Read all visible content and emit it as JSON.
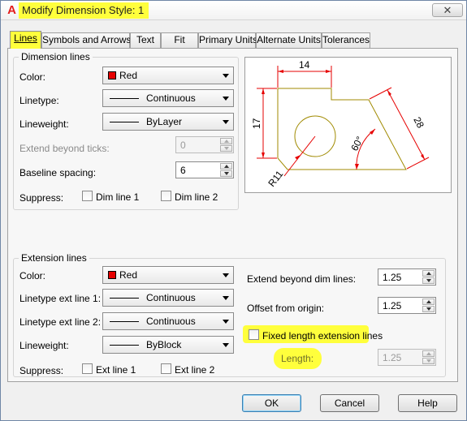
{
  "window": {
    "title": "Modify Dimension Style: 1",
    "icon": "autocad-a-icon",
    "close_label": "✕"
  },
  "tabs": [
    {
      "label": "Lines",
      "active": true
    },
    {
      "label": "Symbols and Arrows"
    },
    {
      "label": "Text"
    },
    {
      "label": "Fit"
    },
    {
      "label": "Primary Units"
    },
    {
      "label": "Alternate Units"
    },
    {
      "label": "Tolerances"
    }
  ],
  "dimension_lines": {
    "group_label": "Dimension lines",
    "color_label": "Color:",
    "color_value": "Red",
    "color_hex": "#e60000",
    "linetype_label": "Linetype:",
    "linetype_value": "Continuous",
    "lineweight_label": "Lineweight:",
    "lineweight_value": "ByLayer",
    "extend_label": "Extend beyond ticks:",
    "extend_value": "0",
    "baseline_label": "Baseline spacing:",
    "baseline_value": "6",
    "suppress_label": "Suppress:",
    "dim_line_1": "Dim line 1",
    "dim_line_2": "Dim line 2"
  },
  "preview": {
    "dim_top": "14",
    "dim_left": "17",
    "dim_diag": "28",
    "dim_angle": "60°",
    "dim_radius": "R11",
    "geometry_color": "#a08a00",
    "dim_color": "#e60000"
  },
  "extension_lines": {
    "group_label": "Extension lines",
    "color_label": "Color:",
    "color_value": "Red",
    "linetype1_label": "Linetype ext line 1:",
    "linetype1_value": "Continuous",
    "linetype2_label": "Linetype ext line 2:",
    "linetype2_value": "Continuous",
    "lineweight_label": "Lineweight:",
    "lineweight_value": "ByBlock",
    "suppress_label": "Suppress:",
    "ext_line_1": "Ext line 1",
    "ext_line_2": "Ext line 2",
    "extend_beyond_label": "Extend beyond dim lines:",
    "extend_beyond_value": "1.25",
    "offset_label": "Offset from origin:",
    "offset_value": "1.25",
    "fixed_length_label": "Fixed length extension lines",
    "length_label": "Length:",
    "length_value": "1.25"
  },
  "buttons": {
    "ok": "OK",
    "cancel": "Cancel",
    "help": "Help"
  },
  "highlight_color": "#ffff3c"
}
